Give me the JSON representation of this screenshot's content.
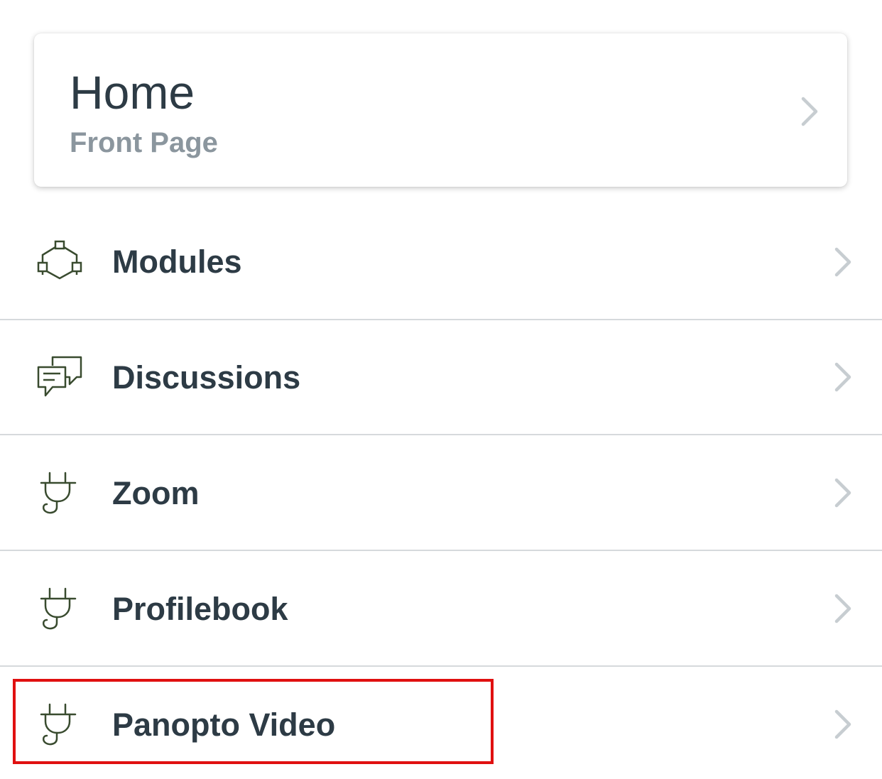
{
  "home": {
    "title": "Home",
    "subtitle": "Front Page",
    "chevron_icon": "chevron-right-icon"
  },
  "items": [
    {
      "label": "Modules",
      "icon": "modules-icon"
    },
    {
      "label": "Discussions",
      "icon": "discussions-icon"
    },
    {
      "label": "Zoom",
      "icon": "plug-icon"
    },
    {
      "label": "Profilebook",
      "icon": "plug-icon"
    },
    {
      "label": "Panopto Video",
      "icon": "plug-icon"
    }
  ],
  "colors": {
    "icon": "#394b2f",
    "text": "#2d3b45",
    "subtitle": "#8b969e",
    "chevron": "#c7cdd1",
    "divider": "#d6d9dc",
    "highlight": "#e01010"
  }
}
